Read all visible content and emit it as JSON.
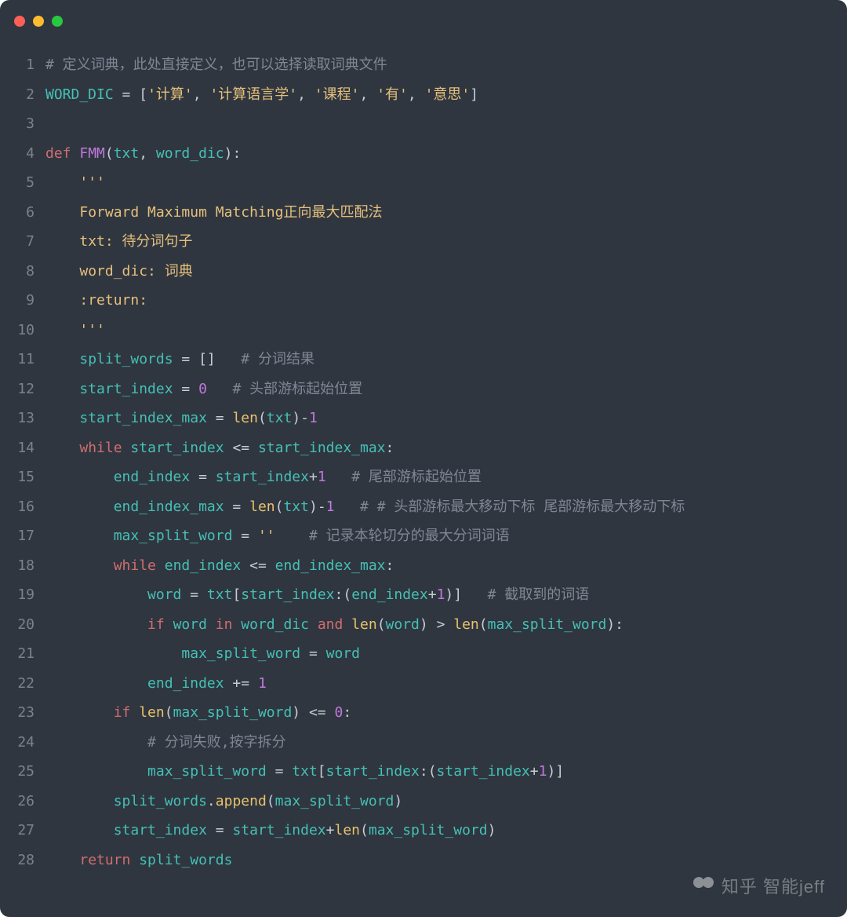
{
  "traffic_lights": {
    "red": "#fe5f57",
    "yellow": "#febc2e",
    "green": "#28c840"
  },
  "watermark": "知乎 智能jeff",
  "lines": [
    {
      "n": 1,
      "tokens": [
        {
          "cls": "cmt",
          "t": "# 定义词典，此处直接定义，也可以选择读取词典文件"
        }
      ]
    },
    {
      "n": 2,
      "tokens": [
        {
          "cls": "var",
          "t": "WORD_DIC"
        },
        {
          "cls": "op",
          "t": " = ["
        },
        {
          "cls": "str",
          "t": "'计算'"
        },
        {
          "cls": "op",
          "t": ", "
        },
        {
          "cls": "str",
          "t": "'计算语言学'"
        },
        {
          "cls": "op",
          "t": ", "
        },
        {
          "cls": "str",
          "t": "'课程'"
        },
        {
          "cls": "op",
          "t": ", "
        },
        {
          "cls": "str",
          "t": "'有'"
        },
        {
          "cls": "op",
          "t": ", "
        },
        {
          "cls": "str",
          "t": "'意思'"
        },
        {
          "cls": "op",
          "t": "]"
        }
      ]
    },
    {
      "n": 3,
      "tokens": [
        {
          "cls": "op",
          "t": ""
        }
      ]
    },
    {
      "n": 4,
      "tokens": [
        {
          "cls": "kw",
          "t": "def "
        },
        {
          "cls": "fn",
          "t": "FMM"
        },
        {
          "cls": "op",
          "t": "("
        },
        {
          "cls": "var",
          "t": "txt"
        },
        {
          "cls": "op",
          "t": ", "
        },
        {
          "cls": "var",
          "t": "word_dic"
        },
        {
          "cls": "op",
          "t": "):"
        }
      ]
    },
    {
      "n": 5,
      "tokens": [
        {
          "cls": "op",
          "t": "    "
        },
        {
          "cls": "str",
          "t": "'''"
        }
      ]
    },
    {
      "n": 6,
      "tokens": [
        {
          "cls": "op",
          "t": "    "
        },
        {
          "cls": "str",
          "t": "Forward Maximum Matching正向最大匹配法"
        }
      ]
    },
    {
      "n": 7,
      "tokens": [
        {
          "cls": "op",
          "t": "    "
        },
        {
          "cls": "str",
          "t": "txt: 待分词句子"
        }
      ]
    },
    {
      "n": 8,
      "tokens": [
        {
          "cls": "op",
          "t": "    "
        },
        {
          "cls": "str",
          "t": "word_dic: 词典"
        }
      ]
    },
    {
      "n": 9,
      "tokens": [
        {
          "cls": "op",
          "t": "    "
        },
        {
          "cls": "str",
          "t": ":return:"
        }
      ]
    },
    {
      "n": 10,
      "tokens": [
        {
          "cls": "op",
          "t": "    "
        },
        {
          "cls": "str",
          "t": "'''"
        }
      ]
    },
    {
      "n": 11,
      "tokens": [
        {
          "cls": "op",
          "t": "    "
        },
        {
          "cls": "var",
          "t": "split_words"
        },
        {
          "cls": "op",
          "t": " = []   "
        },
        {
          "cls": "cmt",
          "t": "# 分词结果"
        }
      ]
    },
    {
      "n": 12,
      "tokens": [
        {
          "cls": "op",
          "t": "    "
        },
        {
          "cls": "var",
          "t": "start_index"
        },
        {
          "cls": "op",
          "t": " = "
        },
        {
          "cls": "num",
          "t": "0"
        },
        {
          "cls": "op",
          "t": "   "
        },
        {
          "cls": "cmt",
          "t": "# 头部游标起始位置"
        }
      ]
    },
    {
      "n": 13,
      "tokens": [
        {
          "cls": "op",
          "t": "    "
        },
        {
          "cls": "var",
          "t": "start_index_max"
        },
        {
          "cls": "op",
          "t": " = "
        },
        {
          "cls": "call",
          "t": "len"
        },
        {
          "cls": "op",
          "t": "("
        },
        {
          "cls": "var",
          "t": "txt"
        },
        {
          "cls": "op",
          "t": ")-"
        },
        {
          "cls": "num",
          "t": "1"
        }
      ]
    },
    {
      "n": 14,
      "tokens": [
        {
          "cls": "op",
          "t": "    "
        },
        {
          "cls": "kw",
          "t": "while "
        },
        {
          "cls": "var",
          "t": "start_index"
        },
        {
          "cls": "op",
          "t": " <= "
        },
        {
          "cls": "var",
          "t": "start_index_max"
        },
        {
          "cls": "op",
          "t": ":"
        }
      ]
    },
    {
      "n": 15,
      "tokens": [
        {
          "cls": "op",
          "t": "        "
        },
        {
          "cls": "var",
          "t": "end_index"
        },
        {
          "cls": "op",
          "t": " = "
        },
        {
          "cls": "var",
          "t": "start_index"
        },
        {
          "cls": "op",
          "t": "+"
        },
        {
          "cls": "num",
          "t": "1"
        },
        {
          "cls": "op",
          "t": "   "
        },
        {
          "cls": "cmt",
          "t": "# 尾部游标起始位置"
        }
      ]
    },
    {
      "n": 16,
      "tokens": [
        {
          "cls": "op",
          "t": "        "
        },
        {
          "cls": "var",
          "t": "end_index_max"
        },
        {
          "cls": "op",
          "t": " = "
        },
        {
          "cls": "call",
          "t": "len"
        },
        {
          "cls": "op",
          "t": "("
        },
        {
          "cls": "var",
          "t": "txt"
        },
        {
          "cls": "op",
          "t": ")-"
        },
        {
          "cls": "num",
          "t": "1"
        },
        {
          "cls": "op",
          "t": "   "
        },
        {
          "cls": "cmt",
          "t": "# # 头部游标最大移动下标 尾部游标最大移动下标"
        }
      ]
    },
    {
      "n": 17,
      "tokens": [
        {
          "cls": "op",
          "t": "        "
        },
        {
          "cls": "var",
          "t": "max_split_word"
        },
        {
          "cls": "op",
          "t": " = "
        },
        {
          "cls": "str",
          "t": "''"
        },
        {
          "cls": "op",
          "t": "    "
        },
        {
          "cls": "cmt",
          "t": "# 记录本轮切分的最大分词词语"
        }
      ]
    },
    {
      "n": 18,
      "tokens": [
        {
          "cls": "op",
          "t": "        "
        },
        {
          "cls": "kw",
          "t": "while "
        },
        {
          "cls": "var",
          "t": "end_index"
        },
        {
          "cls": "op",
          "t": " <= "
        },
        {
          "cls": "var",
          "t": "end_index_max"
        },
        {
          "cls": "op",
          "t": ":"
        }
      ]
    },
    {
      "n": 19,
      "tokens": [
        {
          "cls": "op",
          "t": "            "
        },
        {
          "cls": "var",
          "t": "word"
        },
        {
          "cls": "op",
          "t": " = "
        },
        {
          "cls": "var",
          "t": "txt"
        },
        {
          "cls": "op",
          "t": "["
        },
        {
          "cls": "var",
          "t": "start_index"
        },
        {
          "cls": "op",
          "t": ":("
        },
        {
          "cls": "var",
          "t": "end_index"
        },
        {
          "cls": "op",
          "t": "+"
        },
        {
          "cls": "num",
          "t": "1"
        },
        {
          "cls": "op",
          "t": ")]   "
        },
        {
          "cls": "cmt",
          "t": "# 截取到的词语"
        }
      ]
    },
    {
      "n": 20,
      "tokens": [
        {
          "cls": "op",
          "t": "            "
        },
        {
          "cls": "kw",
          "t": "if "
        },
        {
          "cls": "var",
          "t": "word"
        },
        {
          "cls": "kw",
          "t": " in "
        },
        {
          "cls": "var",
          "t": "word_dic"
        },
        {
          "cls": "kw",
          "t": " and "
        },
        {
          "cls": "call",
          "t": "len"
        },
        {
          "cls": "op",
          "t": "("
        },
        {
          "cls": "var",
          "t": "word"
        },
        {
          "cls": "op",
          "t": ") > "
        },
        {
          "cls": "call",
          "t": "len"
        },
        {
          "cls": "op",
          "t": "("
        },
        {
          "cls": "var",
          "t": "max_split_word"
        },
        {
          "cls": "op",
          "t": "):"
        }
      ]
    },
    {
      "n": 21,
      "tokens": [
        {
          "cls": "op",
          "t": "                "
        },
        {
          "cls": "var",
          "t": "max_split_word"
        },
        {
          "cls": "op",
          "t": " = "
        },
        {
          "cls": "var",
          "t": "word"
        }
      ]
    },
    {
      "n": 22,
      "tokens": [
        {
          "cls": "op",
          "t": "            "
        },
        {
          "cls": "var",
          "t": "end_index"
        },
        {
          "cls": "op",
          "t": " += "
        },
        {
          "cls": "num",
          "t": "1"
        }
      ]
    },
    {
      "n": 23,
      "tokens": [
        {
          "cls": "op",
          "t": "        "
        },
        {
          "cls": "kw",
          "t": "if "
        },
        {
          "cls": "call",
          "t": "len"
        },
        {
          "cls": "op",
          "t": "("
        },
        {
          "cls": "var",
          "t": "max_split_word"
        },
        {
          "cls": "op",
          "t": ") <= "
        },
        {
          "cls": "num",
          "t": "0"
        },
        {
          "cls": "op",
          "t": ":"
        }
      ]
    },
    {
      "n": 24,
      "tokens": [
        {
          "cls": "op",
          "t": "            "
        },
        {
          "cls": "cmt",
          "t": "# 分词失败,按字拆分"
        }
      ]
    },
    {
      "n": 25,
      "tokens": [
        {
          "cls": "op",
          "t": "            "
        },
        {
          "cls": "var",
          "t": "max_split_word"
        },
        {
          "cls": "op",
          "t": " = "
        },
        {
          "cls": "var",
          "t": "txt"
        },
        {
          "cls": "op",
          "t": "["
        },
        {
          "cls": "var",
          "t": "start_index"
        },
        {
          "cls": "op",
          "t": ":("
        },
        {
          "cls": "var",
          "t": "start_index"
        },
        {
          "cls": "op",
          "t": "+"
        },
        {
          "cls": "num",
          "t": "1"
        },
        {
          "cls": "op",
          "t": ")]"
        }
      ]
    },
    {
      "n": 26,
      "tokens": [
        {
          "cls": "op",
          "t": "        "
        },
        {
          "cls": "var",
          "t": "split_words"
        },
        {
          "cls": "op",
          "t": "."
        },
        {
          "cls": "call",
          "t": "append"
        },
        {
          "cls": "op",
          "t": "("
        },
        {
          "cls": "var",
          "t": "max_split_word"
        },
        {
          "cls": "op",
          "t": ")"
        }
      ]
    },
    {
      "n": 27,
      "tokens": [
        {
          "cls": "op",
          "t": "        "
        },
        {
          "cls": "var",
          "t": "start_index"
        },
        {
          "cls": "op",
          "t": " = "
        },
        {
          "cls": "var",
          "t": "start_index"
        },
        {
          "cls": "op",
          "t": "+"
        },
        {
          "cls": "call",
          "t": "len"
        },
        {
          "cls": "op",
          "t": "("
        },
        {
          "cls": "var",
          "t": "max_split_word"
        },
        {
          "cls": "op",
          "t": ")"
        }
      ]
    },
    {
      "n": 28,
      "tokens": [
        {
          "cls": "op",
          "t": "    "
        },
        {
          "cls": "kw",
          "t": "return "
        },
        {
          "cls": "var",
          "t": "split_words"
        }
      ]
    }
  ]
}
